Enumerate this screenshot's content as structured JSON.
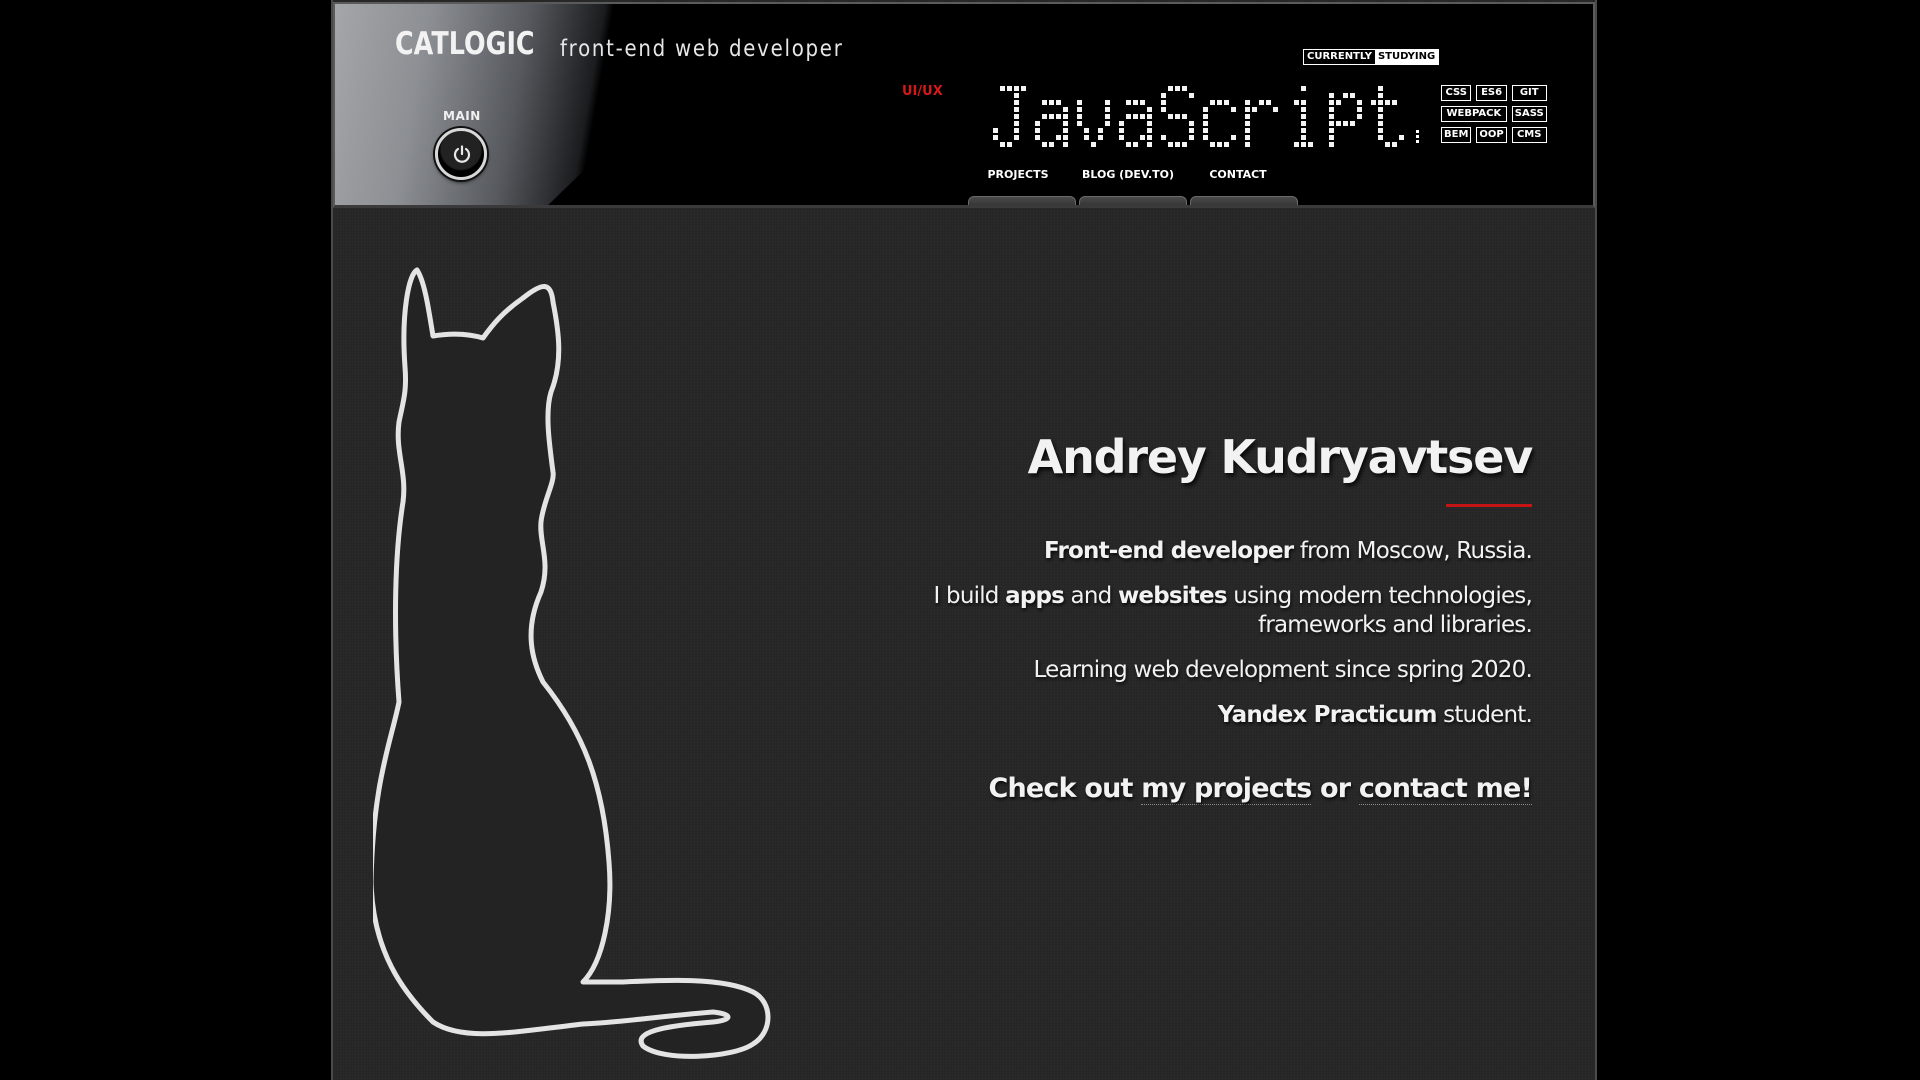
{
  "header": {
    "brand": "CATLOGIC",
    "tagline": "front-end web developer",
    "main_label": "MAIN",
    "uiux": "UI/UX",
    "currently_label_1": "CURRENTLY",
    "currently_label_2": "STUDYING",
    "display_text": "JavaScript",
    "tags": [
      "CSS",
      "ES6",
      "GIT",
      "WEBPACK",
      "SASS",
      "BEM",
      "OOP",
      "CMS"
    ],
    "nav": [
      "PROJECTS",
      "BLOG (DEV.TO)",
      "CONTACT"
    ]
  },
  "intro": {
    "name": "Andrey Kudryavtsev",
    "line1_bold": "Front-end developer",
    "line1_rest": " from Moscow, Russia.",
    "line2_a": "I build ",
    "line2_apps": "apps",
    "line2_b": " and ",
    "line2_websites": "websites",
    "line2_c": " using modern technologies, frameworks and libraries.",
    "line3": "Learning web development since spring 2020.",
    "line4_bold": "Yandex Practicum",
    "line4_rest": " student.",
    "cta_a": "Check out ",
    "cta_projects": "my projects",
    "cta_b": " or ",
    "cta_contact": "contact me!"
  },
  "colors": {
    "accent_red": "#c41414",
    "background": "#262626",
    "header_bg": "#000000",
    "text": "#f2f2f2"
  }
}
